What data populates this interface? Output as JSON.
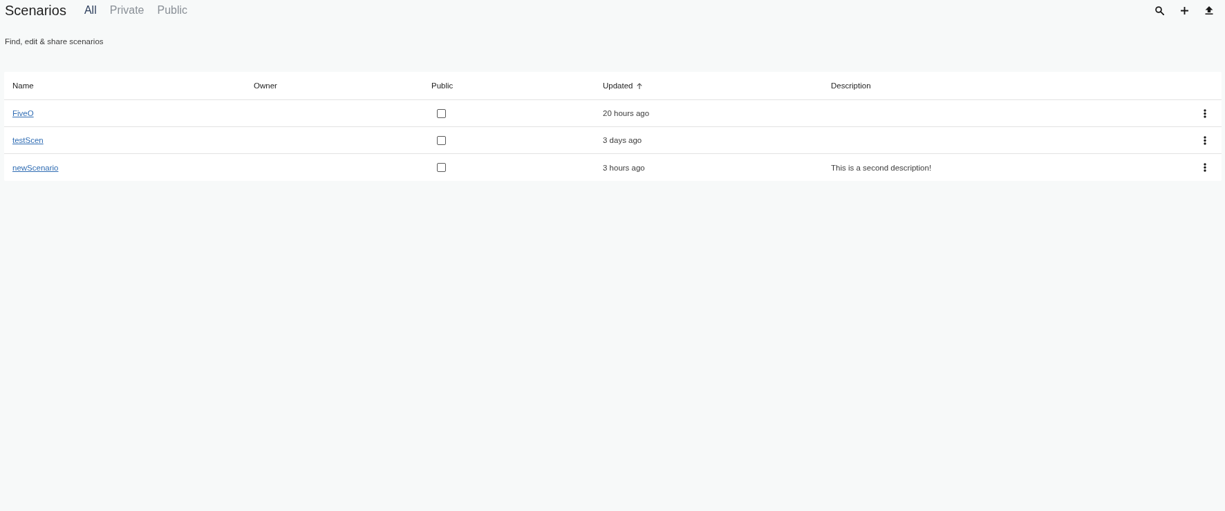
{
  "header": {
    "title": "Scenarios",
    "tabs": [
      {
        "label": "All",
        "selected": true
      },
      {
        "label": "Private",
        "selected": false
      },
      {
        "label": "Public",
        "selected": false
      }
    ],
    "subtitle": "Find, edit & share scenarios"
  },
  "table": {
    "columns": [
      {
        "label": "Name",
        "sorted": false
      },
      {
        "label": "Owner",
        "sorted": false
      },
      {
        "label": "Public",
        "sorted": false
      },
      {
        "label": "Updated",
        "sorted": true
      },
      {
        "label": "Description",
        "sorted": false
      }
    ],
    "rows": [
      {
        "name": "FiveO",
        "public": false,
        "updated": "20 hours ago"
      },
      {
        "name": "testScen",
        "public": false,
        "updated": "3 days ago"
      },
      {
        "name": "newScenario",
        "public": false,
        "updated": "3 hours ago",
        "description": "This is a second description!"
      }
    ]
  }
}
